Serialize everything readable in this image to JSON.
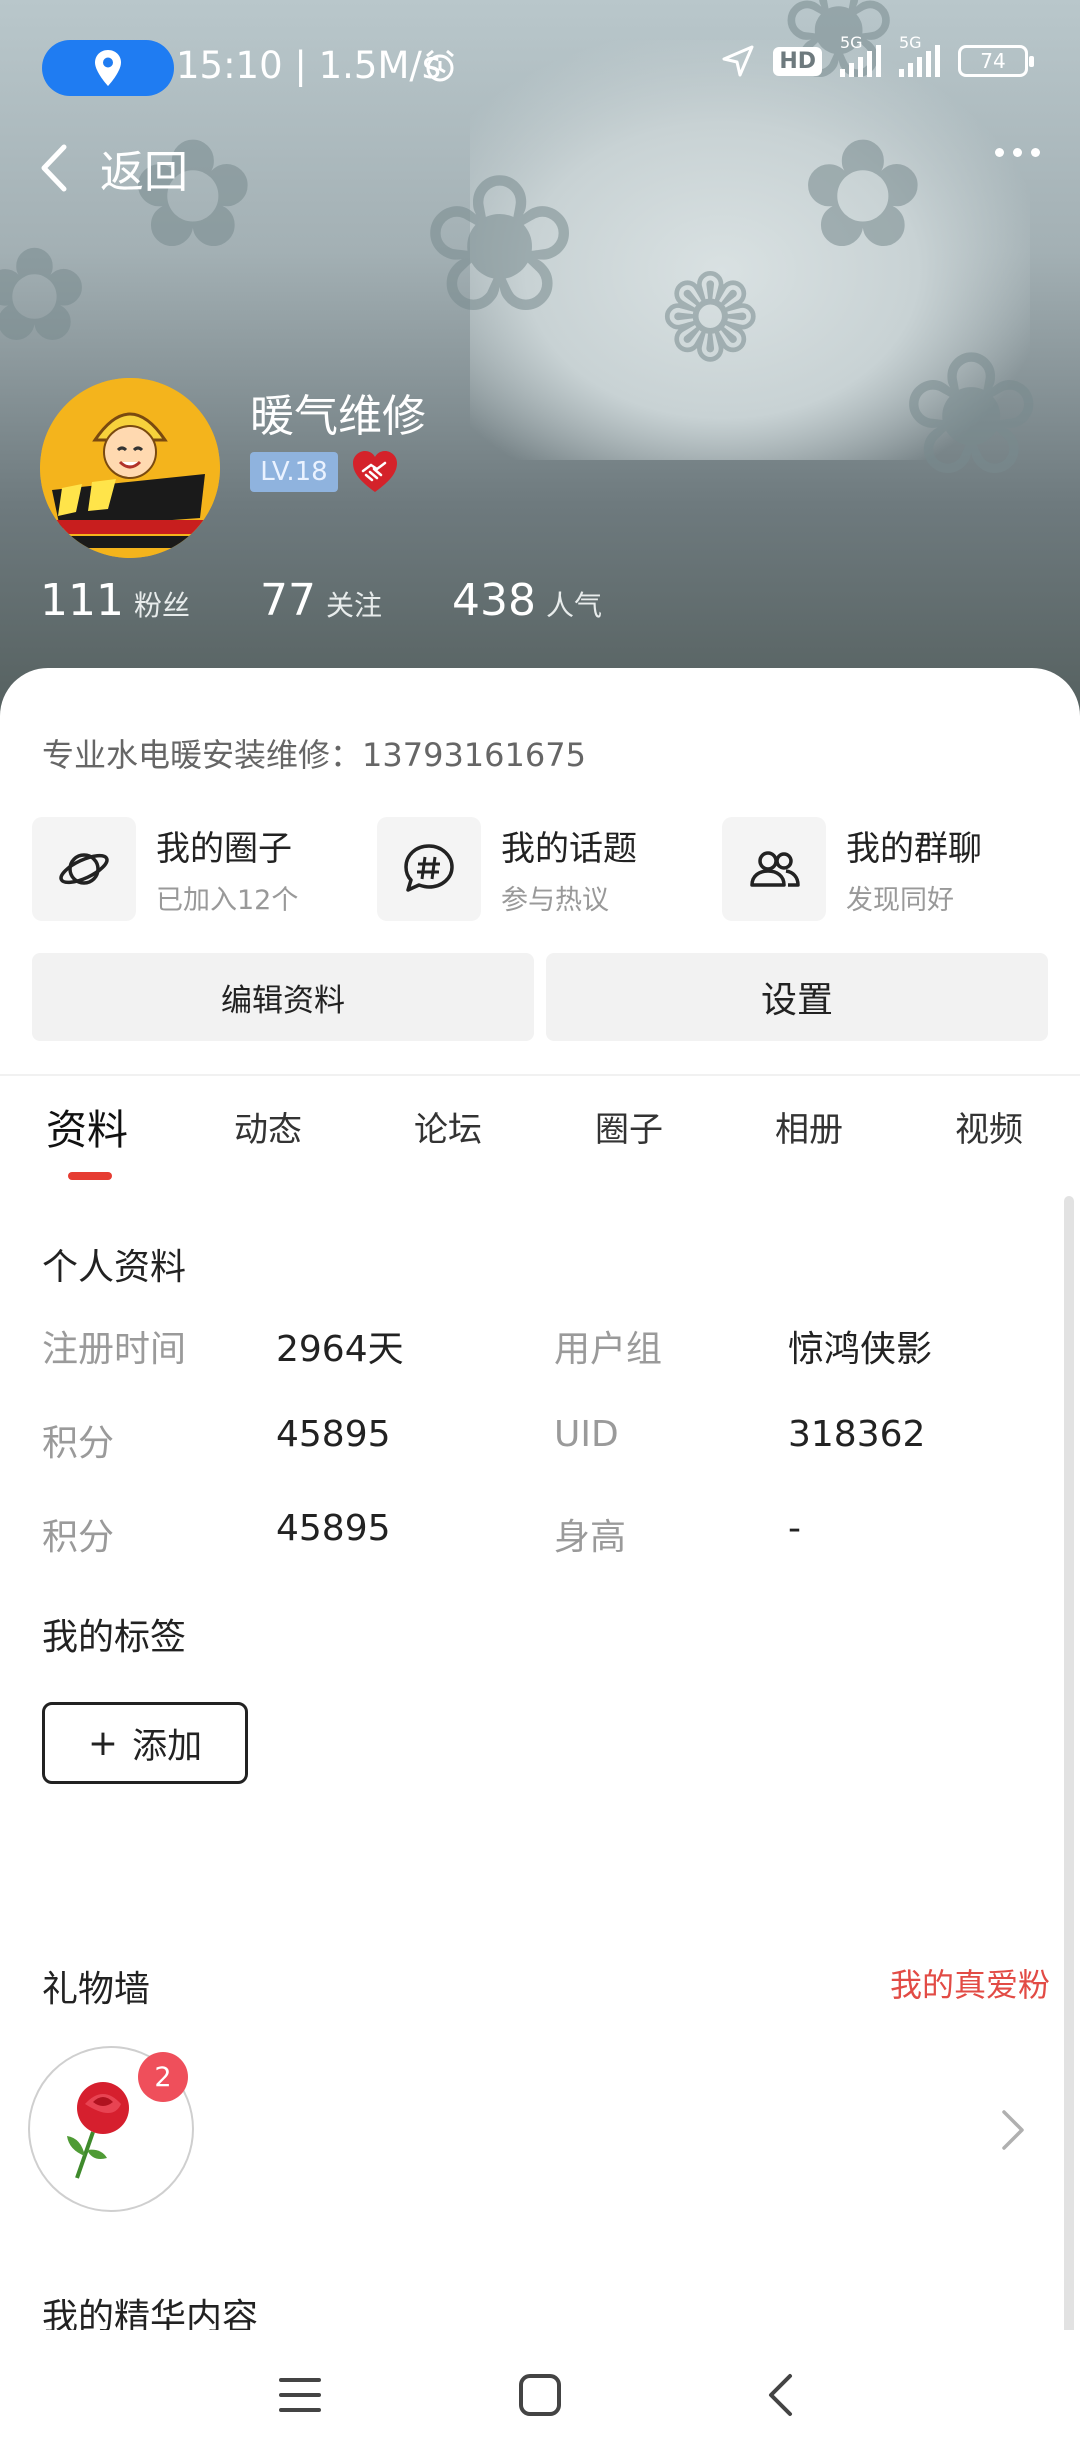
{
  "status_bar": {
    "time_speed": "15:10 | 1.5M/s",
    "hd_label": "HD",
    "net1": "5G",
    "net2": "5G",
    "battery": "74"
  },
  "nav": {
    "back_label": "返回"
  },
  "profile": {
    "name": "暖气维修",
    "level": "LV.18",
    "stats": [
      {
        "value": "111",
        "label": "粉丝"
      },
      {
        "value": "77",
        "label": "关注"
      },
      {
        "value": "438",
        "label": "人气"
      }
    ],
    "bio": "专业水电暖安装维修：13793161675"
  },
  "shortcuts": [
    {
      "title": "我的圈子",
      "sub": "已加入12个",
      "icon": "planet-icon"
    },
    {
      "title": "我的话题",
      "sub": "参与热议",
      "icon": "hashtag-icon"
    },
    {
      "title": "我的群聊",
      "sub": "发现同好",
      "icon": "group-icon"
    }
  ],
  "actions": {
    "edit": "编辑资料",
    "settings": "设置"
  },
  "tabs": [
    "资料",
    "动态",
    "论坛",
    "圈子",
    "相册",
    "视频"
  ],
  "personal": {
    "title": "个人资料",
    "rows": [
      {
        "k1": "注册时间",
        "v1": "2964天",
        "k2": "用户组",
        "v2": "惊鸿侠影"
      },
      {
        "k1": "积分",
        "v1": "45895",
        "k2": "UID",
        "v2": "318362"
      },
      {
        "k1": "积分",
        "v1": "45895",
        "k2": "身高",
        "v2": "-"
      }
    ]
  },
  "tags": {
    "title": "我的标签",
    "add_label": "添加"
  },
  "gifts": {
    "title": "礼物墙",
    "fans_link": "我的真爱粉",
    "count": "2",
    "gift_icon": "🌹"
  },
  "featured": {
    "title": "我的精华内容"
  },
  "colors": {
    "accent": "#e63c32",
    "link_red": "#e24b45",
    "location_pill": "#1f7cf2",
    "level_badge": "#8fb3de"
  }
}
